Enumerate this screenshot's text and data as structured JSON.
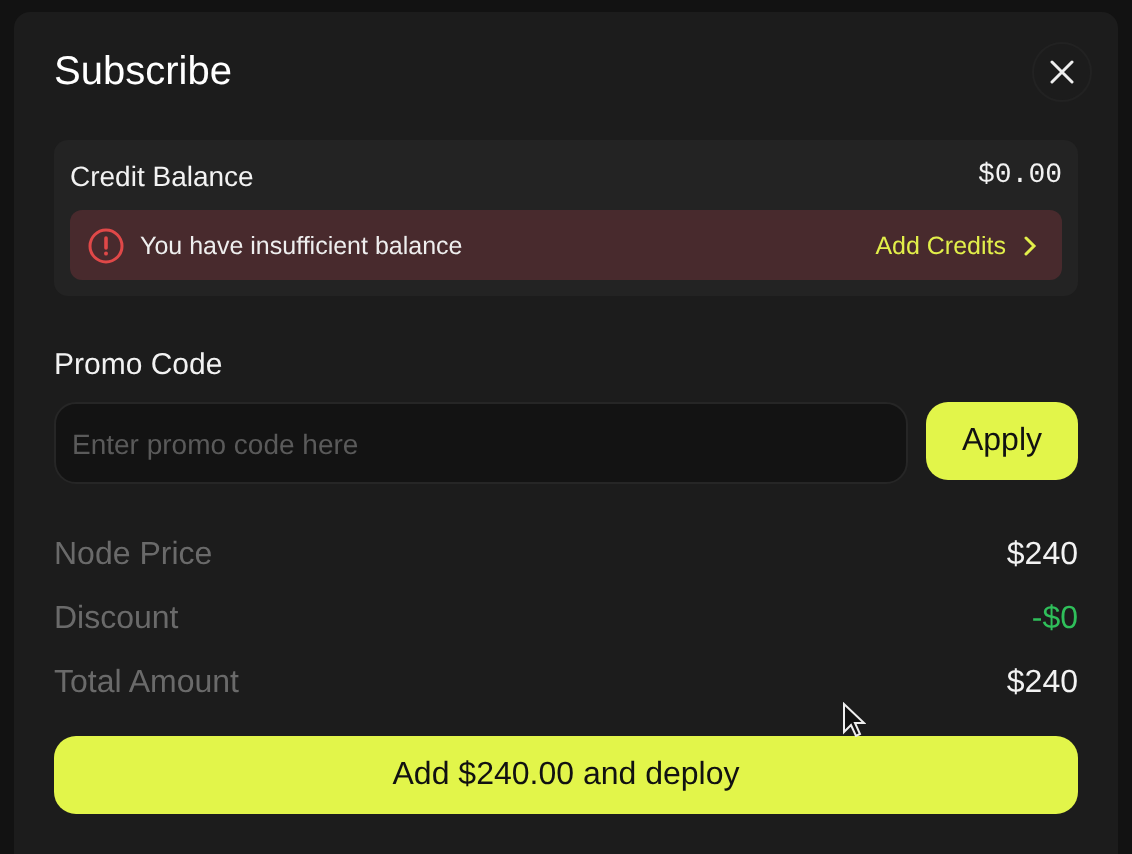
{
  "dialog": {
    "title": "Subscribe"
  },
  "credit": {
    "label": "Credit Balance",
    "amount": "$0.00",
    "alert": {
      "message": "You have insufficient balance",
      "action": "Add Credits"
    }
  },
  "promo": {
    "label": "Promo Code",
    "placeholder": "Enter promo code here",
    "button": "Apply"
  },
  "summary": [
    {
      "label": "Node Price",
      "value": "$240",
      "kind": "amount"
    },
    {
      "label": "Discount",
      "value": "-$0",
      "kind": "discount"
    },
    {
      "label": "Total Amount",
      "value": "$240",
      "kind": "amount"
    }
  ],
  "submit": "Add $240.00 and deploy"
}
